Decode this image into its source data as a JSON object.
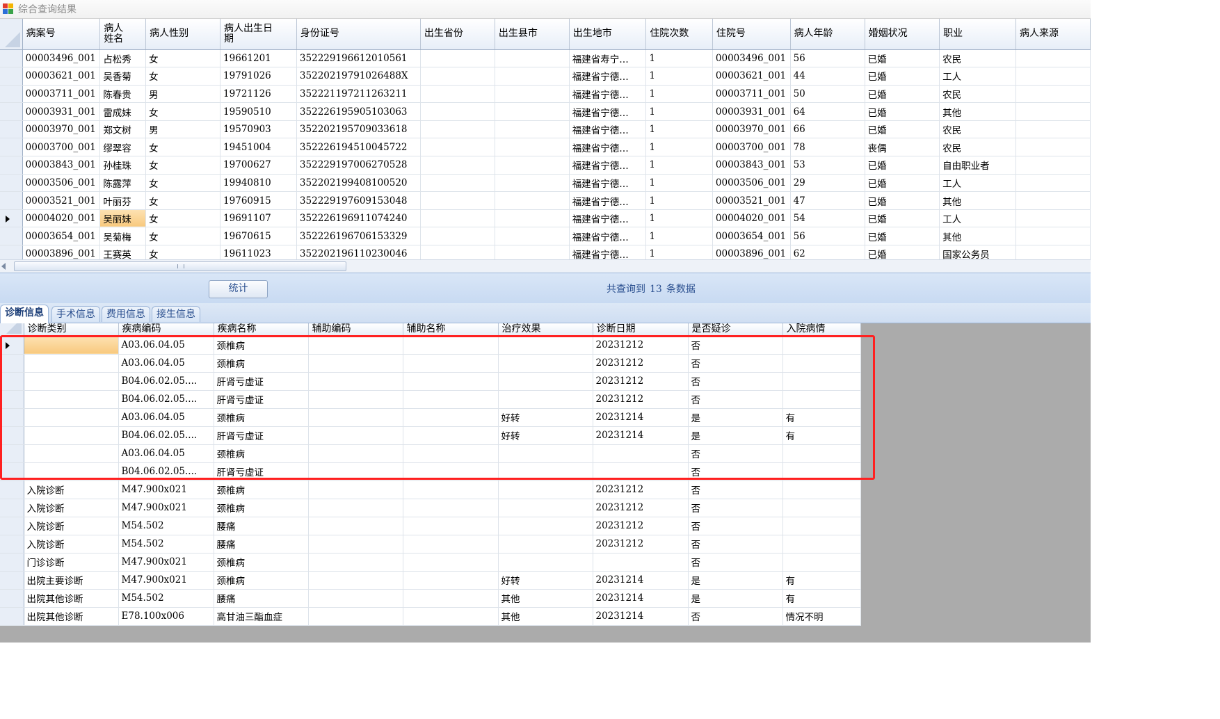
{
  "window": {
    "title": "综合查询结果"
  },
  "patients": {
    "columns": [
      "病案号",
      "病人\n姓名",
      "病人性别",
      "病人出生日\n期",
      "身份证号",
      "出生省份",
      "出生县市",
      "出生地市",
      "住院次数",
      "住院号",
      "病人年龄",
      "婚姻状况",
      "职业",
      "病人来源"
    ],
    "rows": [
      [
        "00003496_001",
        "占松秀",
        "女",
        "19661201",
        "352229196612010561",
        "",
        "",
        "福建省寿宁…",
        "1",
        "00003496_001",
        "56",
        "已婚",
        "农民",
        ""
      ],
      [
        "00003621_001",
        "吴香菊",
        "女",
        "19791026",
        "35220219791026488X",
        "",
        "",
        "福建省宁德…",
        "1",
        "00003621_001",
        "44",
        "已婚",
        "工人",
        ""
      ],
      [
        "00003711_001",
        "陈春贵",
        "男",
        "19721126",
        "352221197211263211",
        "",
        "",
        "福建省宁德…",
        "1",
        "00003711_001",
        "50",
        "已婚",
        "农民",
        ""
      ],
      [
        "00003931_001",
        "雷成妹",
        "女",
        "19590510",
        "352226195905103063",
        "",
        "",
        "福建省宁德…",
        "1",
        "00003931_001",
        "64",
        "已婚",
        "其他",
        ""
      ],
      [
        "00003970_001",
        "郑文树",
        "男",
        "19570903",
        "352202195709033618",
        "",
        "",
        "福建省宁德…",
        "1",
        "00003970_001",
        "66",
        "已婚",
        "农民",
        ""
      ],
      [
        "00003700_001",
        "缪翠容",
        "女",
        "19451004",
        "352226194510045722",
        "",
        "",
        "福建省宁德…",
        "1",
        "00003700_001",
        "78",
        "丧偶",
        "农民",
        ""
      ],
      [
        "00003843_001",
        "孙桂珠",
        "女",
        "19700627",
        "352229197006270528",
        "",
        "",
        "福建省宁德…",
        "1",
        "00003843_001",
        "53",
        "已婚",
        "自由职业者",
        ""
      ],
      [
        "00003506_001",
        "陈露萍",
        "女",
        "19940810",
        "352202199408100520",
        "",
        "",
        "福建省宁德…",
        "1",
        "00003506_001",
        "29",
        "已婚",
        "工人",
        ""
      ],
      [
        "00003521_001",
        "叶丽芬",
        "女",
        "19760915",
        "352229197609153048",
        "",
        "",
        "福建省宁德…",
        "1",
        "00003521_001",
        "47",
        "已婚",
        "其他",
        ""
      ],
      [
        "00004020_001",
        "吴丽妹",
        "女",
        "19691107",
        "352226196911074240",
        "",
        "",
        "福建省宁德…",
        "1",
        "00004020_001",
        "54",
        "已婚",
        "工人",
        ""
      ],
      [
        "00003654_001",
        "吴菊梅",
        "女",
        "19670615",
        "352226196706153329",
        "",
        "",
        "福建省宁德…",
        "1",
        "00003654_001",
        "56",
        "已婚",
        "其他",
        ""
      ],
      [
        "00003896_001",
        "王赛英",
        "女",
        "19611023",
        "352202196110230046",
        "",
        "",
        "福建省宁德…",
        "1",
        "00003896_001",
        "62",
        "已婚",
        "国家公务员",
        ""
      ]
    ],
    "selected_row": 9
  },
  "toolbar": {
    "stat_button": "统计",
    "status_prefix": "共查询到",
    "status_count": "13",
    "status_suffix": "条数据"
  },
  "tabs": [
    "诊断信息",
    "手术信息",
    "费用信息",
    "接生信息"
  ],
  "active_tab": 0,
  "diagnosis": {
    "columns": [
      "诊断类别",
      "疾病编码",
      "疾病名称",
      "辅助编码",
      "辅助名称",
      "治疗效果",
      "诊断日期",
      "是否疑诊",
      "入院病情"
    ],
    "rows": [
      [
        "",
        "A03.06.04.05",
        "颈椎病",
        "",
        "",
        "",
        "20231212",
        "否",
        ""
      ],
      [
        "",
        "A03.06.04.05",
        "颈椎病",
        "",
        "",
        "",
        "20231212",
        "否",
        ""
      ],
      [
        "",
        "B04.06.02.05....",
        "肝肾亏虚证",
        "",
        "",
        "",
        "20231212",
        "否",
        ""
      ],
      [
        "",
        "B04.06.02.05....",
        "肝肾亏虚证",
        "",
        "",
        "",
        "20231212",
        "否",
        ""
      ],
      [
        "",
        "A03.06.04.05",
        "颈椎病",
        "",
        "",
        "好转",
        "20231214",
        "是",
        "有"
      ],
      [
        "",
        "B04.06.02.05....",
        "肝肾亏虚证",
        "",
        "",
        "好转",
        "20231214",
        "是",
        "有"
      ],
      [
        "",
        "A03.06.04.05",
        "颈椎病",
        "",
        "",
        "",
        "",
        "否",
        ""
      ],
      [
        "",
        "B04.06.02.05....",
        "肝肾亏虚证",
        "",
        "",
        "",
        "",
        "否",
        ""
      ],
      [
        "入院诊断",
        "M47.900x021",
        "颈椎病",
        "",
        "",
        "",
        "20231212",
        "否",
        ""
      ],
      [
        "入院诊断",
        "M47.900x021",
        "颈椎病",
        "",
        "",
        "",
        "20231212",
        "否",
        ""
      ],
      [
        "入院诊断",
        "M54.502",
        "腰痛",
        "",
        "",
        "",
        "20231212",
        "否",
        ""
      ],
      [
        "入院诊断",
        "M54.502",
        "腰痛",
        "",
        "",
        "",
        "20231212",
        "否",
        ""
      ],
      [
        "门诊诊断",
        "M47.900x021",
        "颈椎病",
        "",
        "",
        "",
        "",
        "否",
        ""
      ],
      [
        "出院主要诊断",
        "M47.900x021",
        "颈椎病",
        "",
        "",
        "好转",
        "20231214",
        "是",
        "有"
      ],
      [
        "出院其他诊断",
        "M54.502",
        "腰痛",
        "",
        "",
        "其他",
        "20231214",
        "是",
        "有"
      ],
      [
        "出院其他诊断",
        "E78.100x006",
        "高甘油三酯血症",
        "",
        "",
        "其他",
        "20231214",
        "否",
        "情况不明"
      ]
    ],
    "selected_row": 0
  },
  "colors": {
    "highlight_box": "#ff2020",
    "selection": "#f8c97e",
    "status_text": "#2a4f8f"
  }
}
